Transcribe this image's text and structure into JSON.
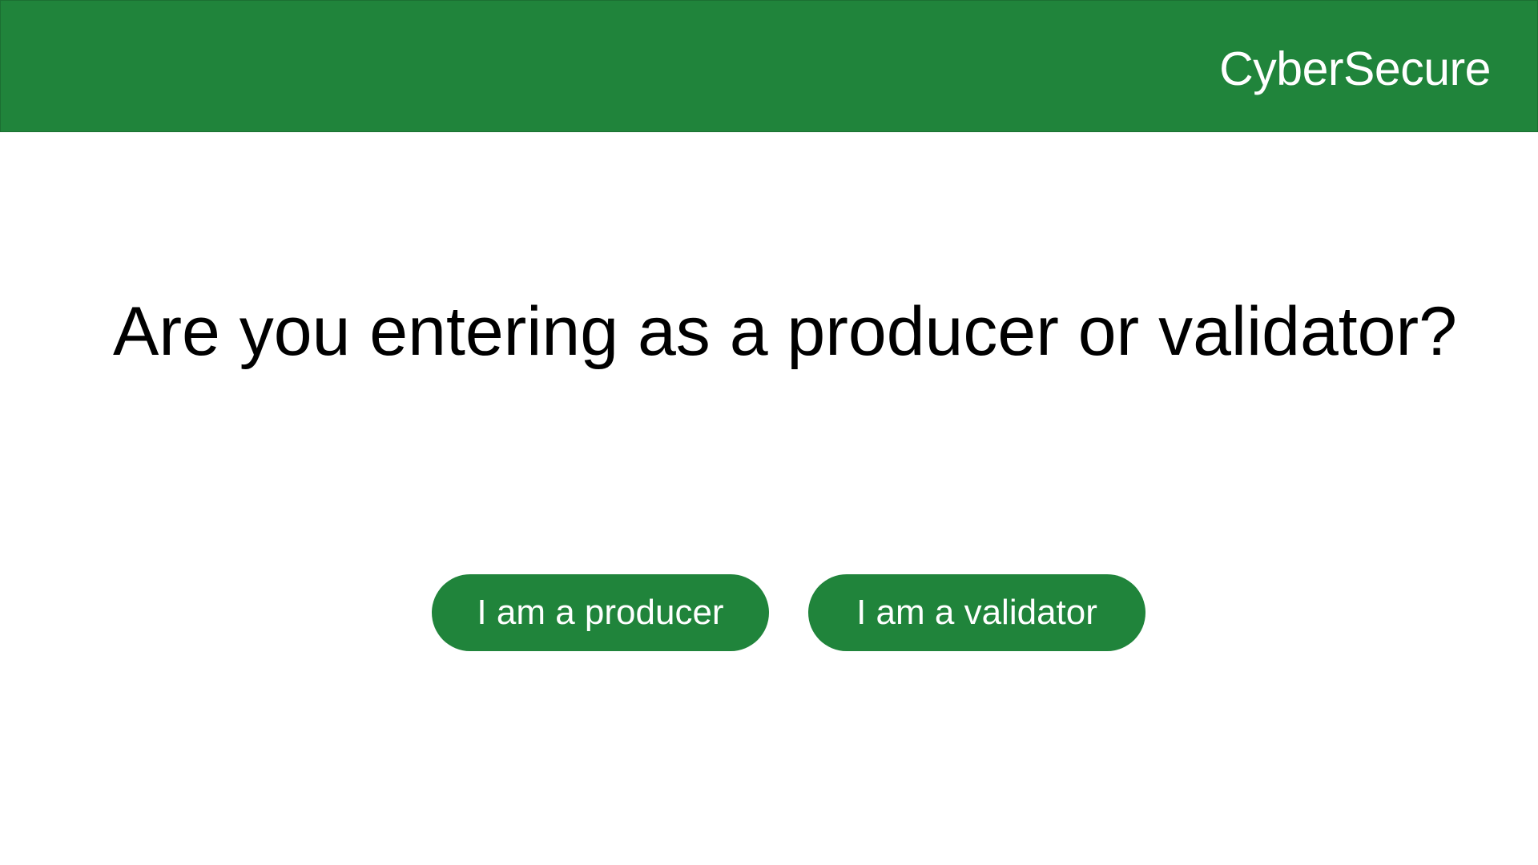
{
  "header": {
    "brand": "CyberSecure"
  },
  "main": {
    "question": "Are you entering as a producer or validator?",
    "buttons": {
      "producer_label": "I am a producer",
      "validator_label": "I am a validator"
    }
  },
  "colors": {
    "brand_green": "#20843b",
    "background": "#ffffff",
    "text": "#000000"
  }
}
